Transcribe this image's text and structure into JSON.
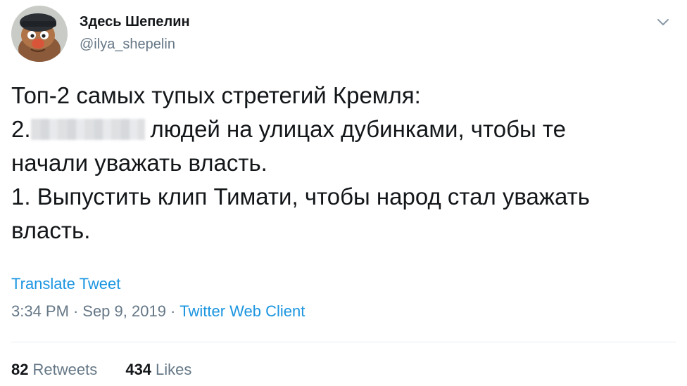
{
  "user": {
    "display_name": "Здесь Шепелин",
    "handle": "@ilya_shepelin",
    "avatar_icon": "avatar-image"
  },
  "tweet": {
    "lines": [
      "Топ-2 самых тупых стретегий Кремля:",
      "2.",
      "людей на улицах дубинками, чтобы те",
      "начали уважать власть.",
      "1. Выпустить клип Тимати, чтобы народ стал уважать",
      "власть."
    ]
  },
  "translate_label": "Translate Tweet",
  "meta": {
    "time": "3:34 PM",
    "separator": "·",
    "date": "Sep 9, 2019",
    "client": "Twitter Web Client"
  },
  "stats": {
    "retweets_count": "82",
    "retweets_label": "Retweets",
    "likes_count": "434",
    "likes_label": "Likes"
  },
  "colors": {
    "link": "#1b95e0",
    "secondary": "#657786",
    "text": "#14171a",
    "divider": "#e6ecf0"
  }
}
